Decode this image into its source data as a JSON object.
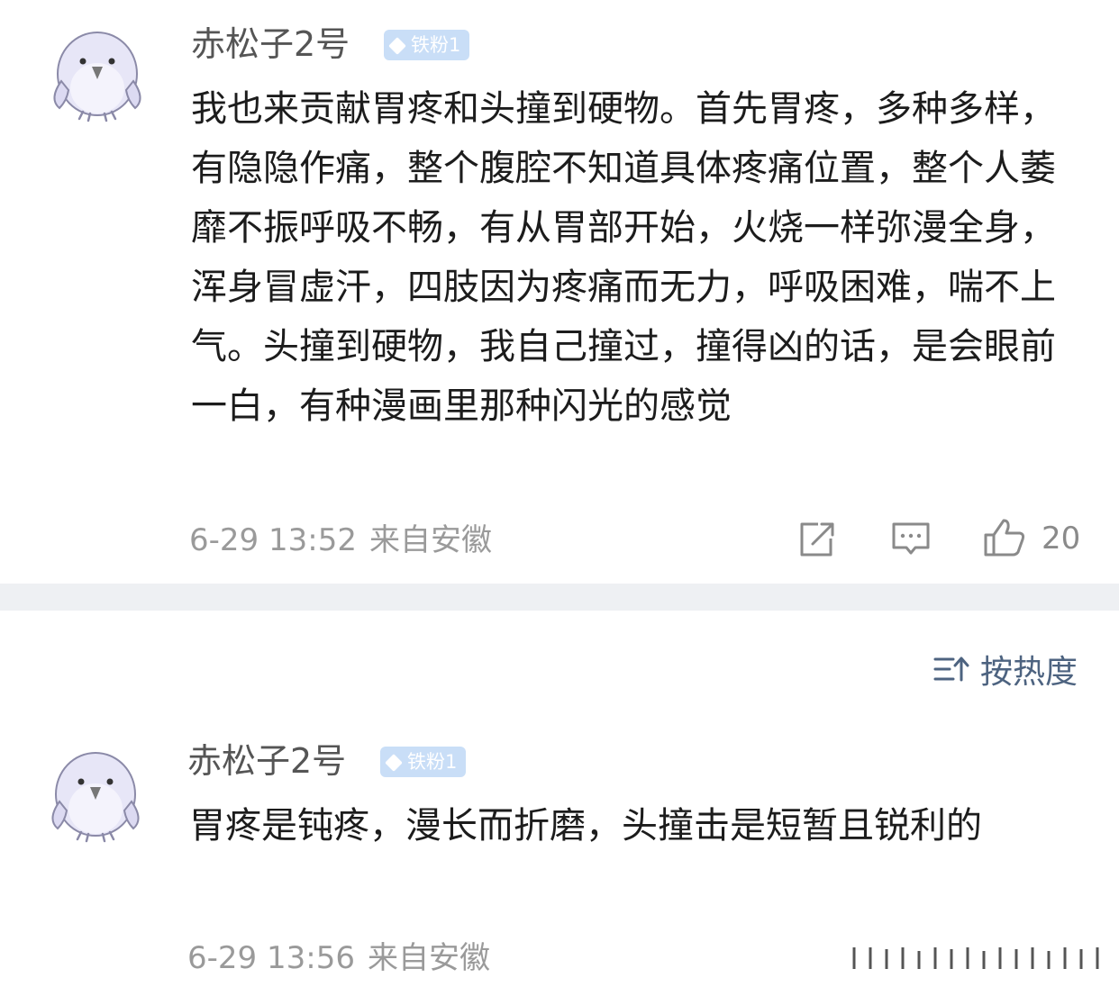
{
  "comments": [
    {
      "username": "赤松子2号",
      "badge": "铁粉1",
      "text": "我也来贡献胃疼和头撞到硬物。首先胃疼，多种多样，有隐隐作痛，整个腹腔不知道具体疼痛位置，整个人萎靡不振呼吸不畅，有从胃部开始，火烧一样弥漫全身，浑身冒虚汗，四肢因为疼痛而无力，呼吸困难，喘不上气。头撞到硬物，我自己撞过，撞得凶的话，是会眼前一白，有种漫画里那种闪光的感觉",
      "time": "6-29 13:52",
      "location": "来自安徽",
      "likes": "20"
    }
  ],
  "sort": {
    "label": "按热度"
  },
  "replies": [
    {
      "username": "赤松子2号",
      "badge": "铁粉1",
      "text": "胃疼是钝疼，漫长而折磨，头撞击是短暂且锐利的",
      "time": "6-29 13:56",
      "location": "来自安徽"
    }
  ],
  "icons": {
    "repost": "share-icon",
    "comment": "comment-icon",
    "like": "thumbs-up-icon",
    "sort": "sort-icon"
  },
  "colors": {
    "badge": "#c9def7",
    "sort_accent": "#4d6380",
    "meta_text": "#9a9a9a",
    "divider": "#eef0f3"
  }
}
